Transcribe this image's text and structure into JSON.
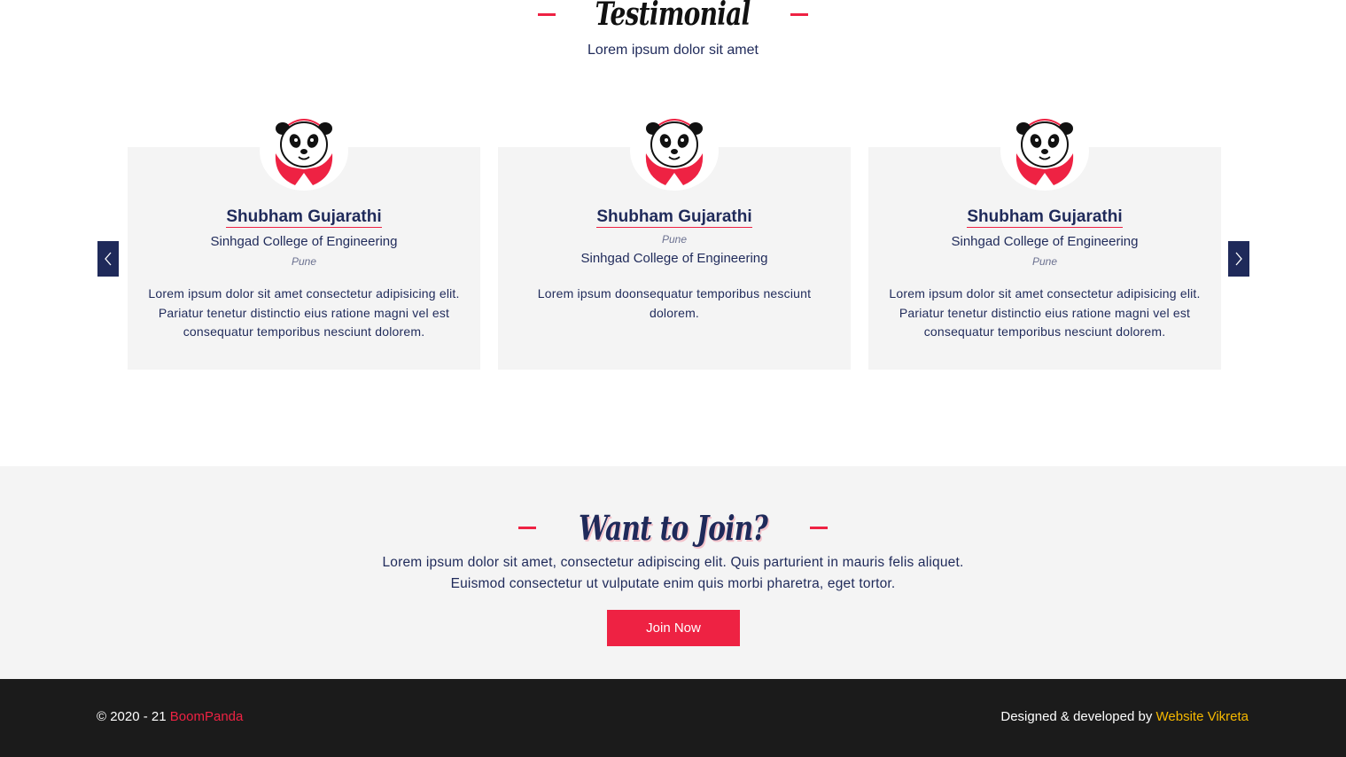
{
  "testimonial": {
    "title": "Testimonial",
    "subtitle": "Lorem ipsum dolor sit amet",
    "cards": [
      {
        "name": "Shubham Gujarathi",
        "college": "Sinhgad College of Engineering",
        "city": "Pune",
        "text": "Lorem ipsum dolor sit amet consectetur adipisicing elit. Pariatur tenetur distinctio eius ratione magni vel est consequatur temporibus nesciunt dolorem."
      },
      {
        "name": "Shubham Gujarathi",
        "college": "Sinhgad College of Engineering",
        "city": "Pune",
        "text": "Lorem ipsum doonsequatur temporibus nesciunt dolorem."
      },
      {
        "name": "Shubham Gujarathi",
        "college": "Sinhgad College of Engineering",
        "city": "Pune",
        "text": "Lorem ipsum dolor sit amet consectetur adipisicing elit. Pariatur tenetur distinctio eius ratione magni vel est consequatur temporibus nesciunt dolorem."
      }
    ],
    "avatar_icon": "panda-logo-icon",
    "prev_icon": "chevron-left-icon",
    "next_icon": "chevron-right-icon"
  },
  "join": {
    "title": "Want to Join?",
    "text": "Lorem ipsum dolor sit amet, consectetur adipiscing elit. Quis parturient in mauris felis aliquet. Euismod consectetur ut vulputate enim quis morbi pharetra, eget tortor.",
    "button_label": "Join Now"
  },
  "footer": {
    "copyright": "© 2020 - 21 ",
    "brand": "BoomPanda",
    "credit": "Designed & developed by ",
    "developer": "Website Vikreta"
  },
  "colors": {
    "accent": "#ee2243",
    "navy": "#1f2a5a",
    "footer_bg": "#1b1b1b",
    "developer_link": "#f5b800"
  }
}
